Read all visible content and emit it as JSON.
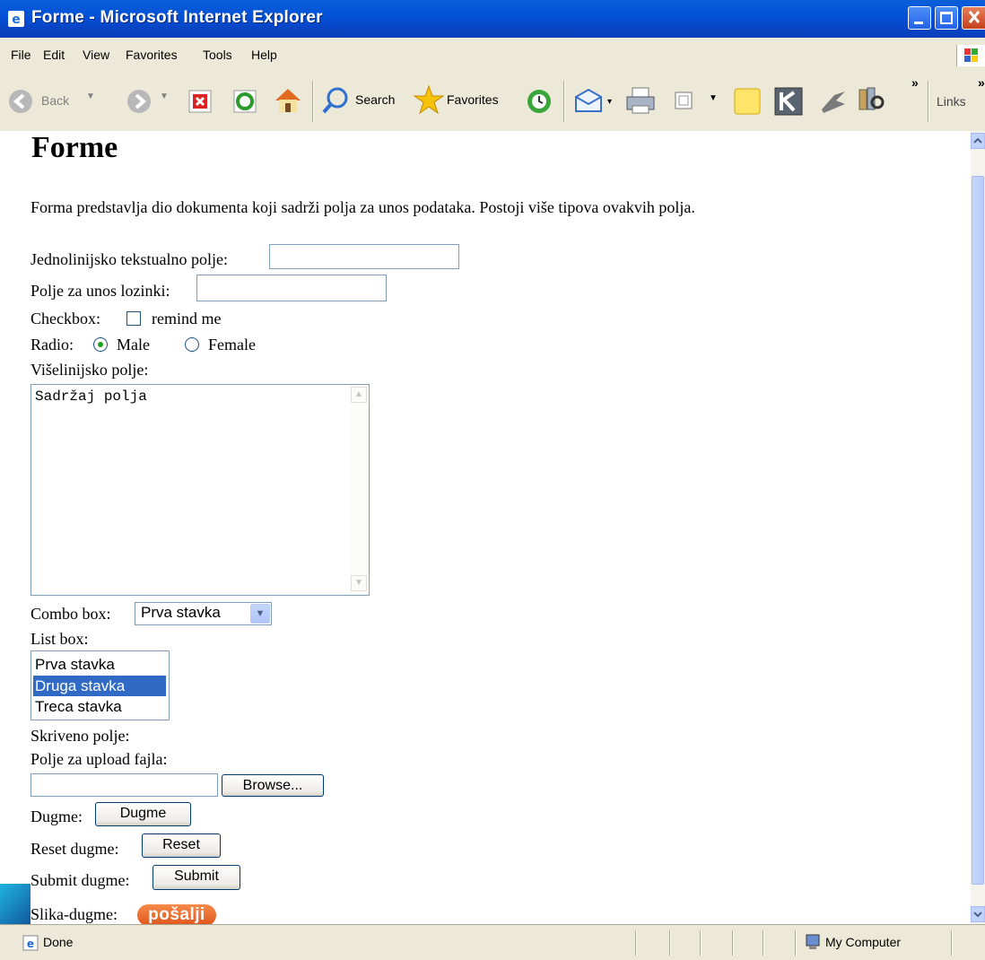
{
  "window": {
    "title": "Forme - Microsoft Internet Explorer"
  },
  "menu": [
    "File",
    "Edit",
    "View",
    "Favorites",
    "Tools",
    "Help"
  ],
  "toolbar": {
    "back": "Back",
    "search": "Search",
    "favorites": "Favorites",
    "chevron": "»",
    "links": "Links"
  },
  "page": {
    "heading": "Forme",
    "intro": "Forma predstavlja dio dokumenta koji sadrži polja za unos podataka. Postoji više tipova ovakvih polja.",
    "text_field_label": "Jednolinijsko tekstualno polje:",
    "text_field_value": "",
    "password_label": "Polje za unos lozinki:",
    "password_value": "",
    "checkbox_label": "Checkbox:",
    "checkbox_text": "remind me",
    "checkbox_checked": false,
    "radio_label": "Radio:",
    "radio_male": "Male",
    "radio_female": "Female",
    "radio_selected": "Male",
    "textarea_label": "Višelinijsko polje:",
    "textarea_value": "Sadržaj polja",
    "combo_label": "Combo box:",
    "combo_value": "Prva stavka",
    "listbox_label": "List box:",
    "listbox_items": [
      "Prva stavka",
      "Druga stavka",
      "Treca stavka"
    ],
    "listbox_selected": "Druga stavka",
    "hidden_label": "Skriveno polje:",
    "upload_label": "Polje za upload fajla:",
    "browse_button": "Browse...",
    "button_label": "Dugme:",
    "button_text": "Dugme",
    "reset_label": "Reset dugme:",
    "reset_text": "Reset",
    "submit_label": "Submit dugme:",
    "submit_text": "Submit",
    "image_button_label": "Slika-dugme:",
    "image_button_text": "pošalji"
  },
  "status": {
    "left": "Done",
    "zone": "My Computer"
  },
  "colors": {
    "titlebar": "#0a4fd4",
    "chrome": "#ece9d8",
    "selection": "#316ac5",
    "image_button": "#e8642a"
  },
  "icons": [
    "ie-icon",
    "back-icon",
    "forward-icon",
    "stop-icon",
    "refresh-icon",
    "home-icon",
    "search-icon",
    "favorites-icon",
    "history-icon",
    "mail-icon",
    "print-icon",
    "edit-icon",
    "note-icon",
    "k-icon",
    "messenger-icon",
    "research-icon",
    "windows-flag-icon",
    "computer-icon"
  ]
}
